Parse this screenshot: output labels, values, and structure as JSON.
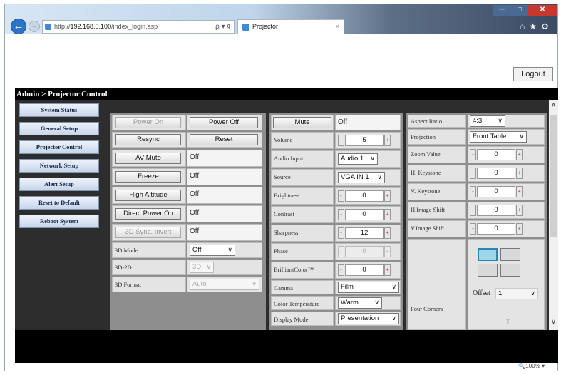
{
  "browser": {
    "url_prefix": "http://",
    "url_host": "192.168.0.100",
    "url_path": "/index_login.asp",
    "address_tools": "ρ ▾ ¢",
    "tab_title": "Projector",
    "tab_close": "×",
    "win_min": "─",
    "win_max": "□",
    "win_close": "✕",
    "icons": "⌂★⚙",
    "zoom": "🔍100%  ▾"
  },
  "page": {
    "logout_label": "Logout",
    "breadcrumb": "Admin > Projector Control"
  },
  "sidebar": {
    "items": [
      {
        "label": "System Status"
      },
      {
        "label": "General Setup"
      },
      {
        "label": "Projector Control"
      },
      {
        "label": "Network Setup"
      },
      {
        "label": "Alert Setup"
      },
      {
        "label": "Reset to Default"
      },
      {
        "label": "Reboot System"
      }
    ]
  },
  "left_panel": {
    "power_on": "Power On",
    "power_off": "Power Off",
    "resync": "Resync",
    "reset": "Reset",
    "av_mute": "AV Mute",
    "av_mute_value": "Off",
    "freeze": "Freeze",
    "freeze_value": "Off",
    "high_altitude": "High Altitude",
    "high_altitude_value": "Off",
    "direct_power_on": "Direct Power On",
    "direct_power_on_value": "Off",
    "sync_invert": "3D Sync. Invert",
    "sync_invert_value": "Off",
    "mode_3d_label": "3D Mode",
    "mode_3d_value": "Off",
    "to_2d_label": "3D-2D",
    "to_2d_value": "3D",
    "format_3d_label": "3D Format",
    "format_3d_value": "Auto"
  },
  "mid_panel": {
    "mute": "Mute",
    "mute_value": "Off",
    "volume_label": "Volume",
    "volume": "5",
    "audio_input_label": "Audio Input",
    "audio_input": "Audio 1",
    "source_label": "Source",
    "source": "VGA IN 1",
    "brightness_label": "Brightness",
    "brightness": "0",
    "contrast_label": "Contrast",
    "contrast": "0",
    "sharpness_label": "Sharpness",
    "sharpness": "12",
    "phase_label": "Phase",
    "phase": "0",
    "brilliantcolor_label": "BrilliantColor™",
    "brilliantcolor": "0",
    "gamma_label": "Gamma",
    "gamma": "Film",
    "color_temp_label": "Color Temperature",
    "color_temp": "Warm",
    "display_mode_label": "Display Mode",
    "display_mode": "Presentation"
  },
  "right_panel": {
    "aspect_ratio_label": "Aspect Ratio",
    "aspect_ratio": "4:3",
    "projection_label": "Projection",
    "projection": "Front Table",
    "zoom_label": "Zoom Value",
    "zoom": "0",
    "h_keystone_label": "H. Keystone",
    "h_keystone": "0",
    "v_keystone_label": "V. Keystone",
    "v_keystone": "0",
    "h_shift_label": "H.Image Shift",
    "h_shift": "0",
    "v_shift_label": "V.Image Shift",
    "v_shift": "0",
    "four_corners_label": "Four Corners",
    "offset_label": "Offset",
    "offset": "1"
  },
  "stepper": {
    "minus": "-",
    "plus": "+"
  },
  "caret": "∨",
  "colors": {
    "title_bar": "#000000",
    "content_bg": "#2d2d2d",
    "nav_text": "#13254a",
    "accent": "#2c74c8"
  }
}
